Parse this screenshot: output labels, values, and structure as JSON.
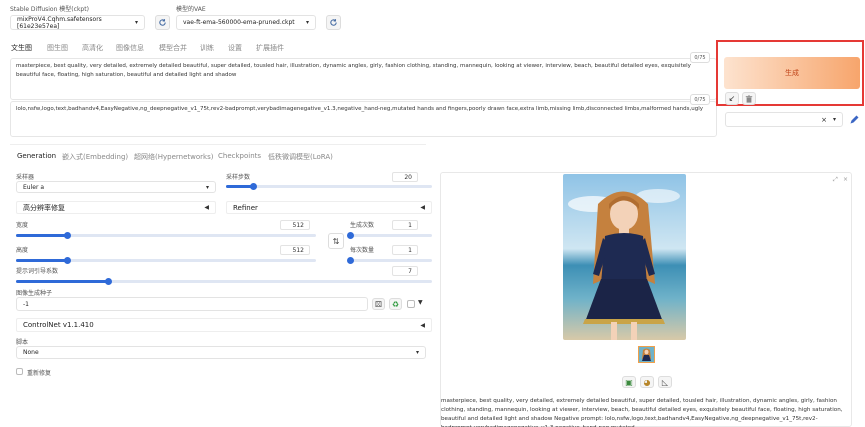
{
  "header": {
    "model_label": "Stable Diffusion 模型(ckpt)",
    "model_value": "mixProV4.Cqhm.safetensors [61e23e57ea]",
    "vae_label": "模型的VAE",
    "vae_value": "vae-ft-ema-560000-ema-pruned.ckpt"
  },
  "tabs": [
    "文生图",
    "图生图",
    "高清化",
    "图像信息",
    "模型合并",
    "训练",
    "设置",
    "扩展插件"
  ],
  "prompt": {
    "text": "masterpiece, best quality, very detailed, extremely detailed beautiful, super detailed, tousled hair, illustration, dynamic angles, girly, fashion clothing, standing, mannequin, looking at viewer, interview, beach, beautiful detailed eyes, exquisitely beautiful face, floating, high saturation, beautiful and detailed light and shadow",
    "count": "0/75"
  },
  "negative_prompt": {
    "text": "lolo,nsfw,logo,text,badhandv4,EasyNegative,ng_deepnegative_v1_75t,rev2-badprompt,verybadimagenegative_v1.3,negative_hand-neg,mutated hands and fingers,poorly drawn face,extra limb,missing limb,disconnected limbs,malformed hands,ugly",
    "count": "0/75"
  },
  "generate_label": "生成",
  "sub_tabs": [
    "Generation",
    "嵌入式(Embedding)",
    "超网络(Hypernetworks)",
    "Checkpoints",
    "低秩微调模型(LoRA)"
  ],
  "params": {
    "sampler_label": "采样器",
    "sampler_value": "Euler a",
    "steps_label": "采样步数",
    "steps_value": "20",
    "steps_fraction": 0.13,
    "hires_label": "高分辨率修复",
    "refiner_label": "Refiner",
    "width_label": "宽度",
    "width_value": "512",
    "width_fraction": 0.17,
    "height_label": "高度",
    "height_value": "512",
    "height_fraction": 0.17,
    "batch_count_label": "生成次数",
    "batch_count_value": "1",
    "batch_count_fraction": 0.0,
    "batch_size_label": "每次数量",
    "batch_size_value": "1",
    "batch_size_fraction": 0.0,
    "cfg_label": "提示词引导系数",
    "cfg_value": "7",
    "cfg_fraction": 0.22,
    "seed_label": "图像生成种子",
    "seed_value": "-1",
    "controlnet_label": "ControlNet v1.1.410",
    "script_label": "脚本",
    "script_value": "None",
    "restore_label": "重新修复"
  },
  "output": {
    "info_text": "masterpiece, best quality, very detailed, extremely detailed beautiful, super detailed, tousled hair, illustration, dynamic angles, girly, fashion clothing, standing, mannequin, looking at viewer, interview, beach, beautiful detailed eyes, exquisitely beautiful face, floating, high saturation, beautiful and detailed light and shadow",
    "negative_text": "Negative prompt: lolo,nsfw,logo,text,badhandv4,EasyNegative,ng_deepnegative_v1_75t,rev2-badprompt,verybadimagenegative_v1.3,negative_hand-neg,mutated"
  },
  "colors": {
    "accent": "#2f6ad8",
    "generate_from": "#fde3cf",
    "generate_to": "#f7a56c",
    "highlight_border": "#e53935"
  },
  "icons": [
    "refresh-icon",
    "trash-icon",
    "paint-icon",
    "dice-icon",
    "recycle-icon",
    "swap-icon",
    "image-icon",
    "palette-icon",
    "ruler-icon",
    "close-icon",
    "chevron-down-icon"
  ]
}
